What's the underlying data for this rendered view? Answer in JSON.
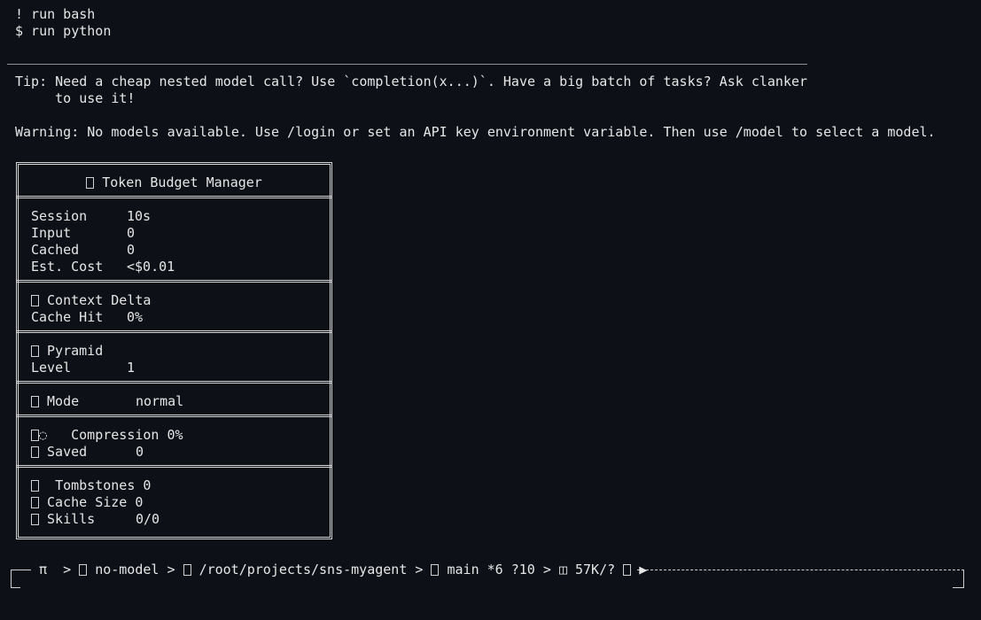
{
  "history": {
    "line1": "! run bash",
    "line2": "$ run python"
  },
  "tip": {
    "line1": "Tip: Need a cheap nested model call? Use `completion(x...)`. Have a big batch of tasks? Ask clanker",
    "line2": "     to use it!"
  },
  "warning": "Warning: No models available. Use /login or set an API key environment variable. Then use /model to select a model.",
  "budget": {
    "title": "Token Budget Manager",
    "title_icon": "token-icon",
    "stats": [
      {
        "label": "Session",
        "value": "10s"
      },
      {
        "label": "Input",
        "value": "0"
      },
      {
        "label": "Cached",
        "value": "0"
      },
      {
        "label": "Est. Cost",
        "value": "<$0.01"
      }
    ],
    "context": {
      "heading": "Context Delta",
      "label": "Cache Hit",
      "value": "0%"
    },
    "pyramid": {
      "heading": "Pyramid",
      "label": "Level",
      "value": "1"
    },
    "mode": {
      "label": "Mode",
      "value": "normal"
    },
    "compression": {
      "label": "Compression",
      "value": "0%",
      "saved_label": "Saved",
      "saved_value": "0"
    },
    "tombstones": {
      "label": "Tombstones",
      "value": "0"
    },
    "cache_size": {
      "label": "Cache Size",
      "value": "0"
    },
    "skills": {
      "label": "Skills",
      "value": "0/0"
    }
  },
  "statusbar": {
    "pi": "π",
    "model": "no-model",
    "path": "/root/projects/sns-myagent",
    "branch": "main *6 ?10",
    "tokens": "57K/?"
  }
}
